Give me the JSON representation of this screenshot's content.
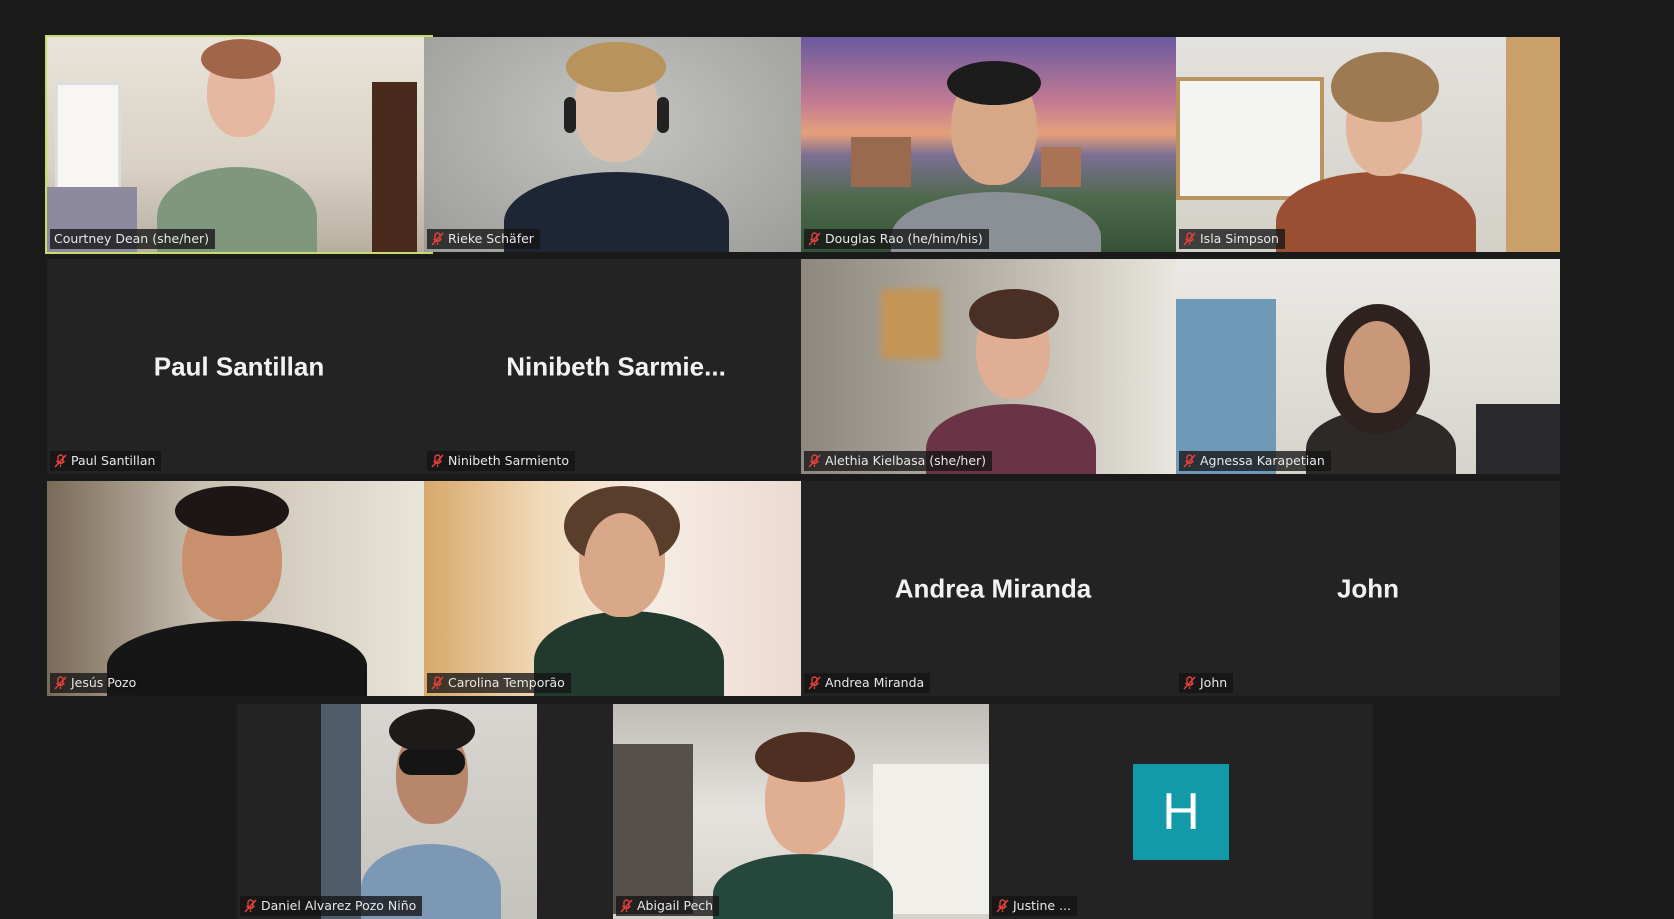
{
  "participants": [
    {
      "name": "Courtney Dean (she/her)",
      "muted": false,
      "active_speaker": true
    },
    {
      "name": "Rieke Schäfer",
      "muted": true
    },
    {
      "name": "Douglas Rao (he/him/his)",
      "muted": true
    },
    {
      "name": "Isla Simpson",
      "muted": true
    },
    {
      "name": "Paul Santillan",
      "display_name": "Paul Santillan",
      "muted": true,
      "video_off": true
    },
    {
      "name": "Ninibeth Sarmiento",
      "display_name": "Ninibeth  Sarmie...",
      "muted": true,
      "video_off": true
    },
    {
      "name": "Alethia Kielbasa (she/her)",
      "muted": true
    },
    {
      "name": "Agnessa Karapetian",
      "muted": true
    },
    {
      "name": "Jesús Pozo",
      "muted": true
    },
    {
      "name": "Carolina Temporão",
      "muted": true
    },
    {
      "name": "Andrea Miranda",
      "display_name": "Andrea Miranda",
      "muted": true,
      "video_off": true
    },
    {
      "name": "John",
      "display_name": "John",
      "muted": true,
      "video_off": true
    },
    {
      "name": "Daniel Alvarez Pozo Niño",
      "muted": true
    },
    {
      "name": "Abigail Pech",
      "muted": true
    },
    {
      "name": "Justine ...",
      "avatar_letter": "H",
      "muted": true,
      "video_off": true
    }
  ],
  "colors": {
    "background": "#1a1a1a",
    "tile": "#232323",
    "active_border": "#c8dc6e",
    "muted_icon": "#e0413d",
    "avatar": "#139aa8"
  }
}
